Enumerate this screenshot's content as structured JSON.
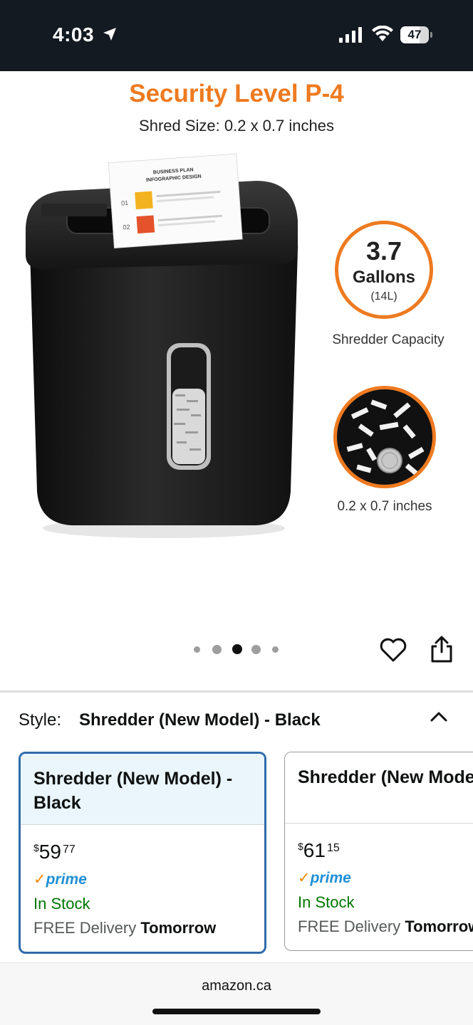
{
  "status_bar": {
    "time": "4:03",
    "battery": "47",
    "icons": [
      "location-arrow-icon",
      "cellular-signal-icon",
      "wifi-icon",
      "battery-icon"
    ]
  },
  "product_image": {
    "title": "Security Level P-4",
    "subtitle": "Shred Size: 0.2 x 0.7 inches",
    "paper_heading_1": "BUSINESS PLAN",
    "paper_heading_2": "INFOGRAPHIC DESIGN",
    "paper_num_1": "01",
    "paper_num_2": "02",
    "capacity_value": "3.7",
    "capacity_unit": "Gallons",
    "capacity_liters": "(14L)",
    "capacity_label": "Shredder Capacity",
    "shred_size_label": "0.2 x 0.7 inches",
    "accent_color": "#ee7a20",
    "carousel": {
      "total": 5,
      "active": 3
    }
  },
  "style_selector": {
    "label": "Style:",
    "selected_value": "Shredder (New Model) - Black",
    "options": [
      {
        "name": "Shredder (New Model) -\nBlack",
        "price_whole": "59",
        "price_cents": "77",
        "currency": "$",
        "prime": "prime",
        "availability": "In Stock",
        "delivery_prefix": "FREE Delivery",
        "delivery_day": "Tomorrow",
        "selected": true
      },
      {
        "name": "Shredder (New Model) -\nWhite",
        "price_whole": "61",
        "price_cents": "15",
        "currency": "$",
        "prime": "prime",
        "availability": "In Stock",
        "delivery_prefix": "FREE Delivery",
        "delivery_day": "Tomorrow",
        "selected": false
      }
    ]
  },
  "footer": {
    "domain": "amazon.ca"
  },
  "colors": {
    "selected_border": "#2f6bab",
    "in_stock": "#007600",
    "prime_blue": "#1f8fd6",
    "status_bar_bg": "#131a22"
  }
}
